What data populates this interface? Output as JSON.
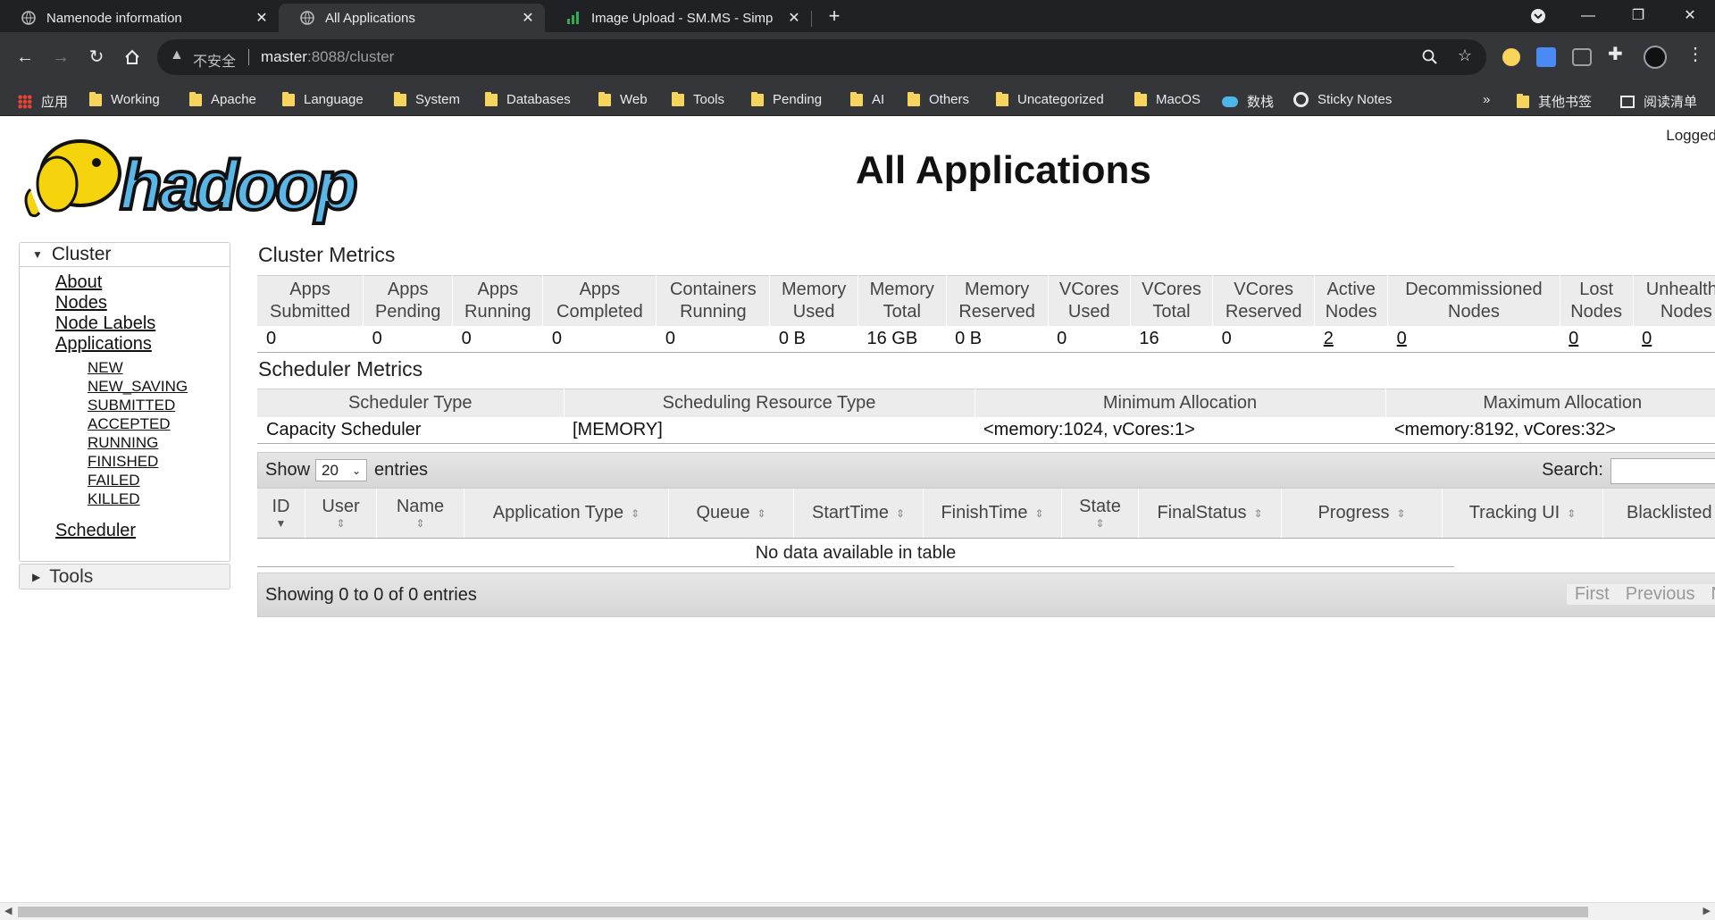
{
  "browser": {
    "tabs": [
      {
        "title": "Namenode information",
        "icon": "globe-icon",
        "close": "✕"
      },
      {
        "title": "All Applications",
        "icon": "globe-icon",
        "close": "✕",
        "active": true
      },
      {
        "title": "Image Upload - SM.MS - Simp",
        "icon": "bar-chart-icon",
        "close": "✕"
      }
    ],
    "new_tab": "+",
    "address": {
      "warning": "▲",
      "insecure": "不安全",
      "host": "master",
      "path": ":8088/cluster"
    },
    "bookmarks": [
      {
        "label": "应用",
        "icon": "apps-grid-icon"
      },
      {
        "label": "Working",
        "icon": "folder-icon"
      },
      {
        "label": "Apache",
        "icon": "folder-icon"
      },
      {
        "label": "Language",
        "icon": "folder-icon"
      },
      {
        "label": "System",
        "icon": "folder-icon"
      },
      {
        "label": "Databases",
        "icon": "folder-icon"
      },
      {
        "label": "Web",
        "icon": "folder-icon"
      },
      {
        "label": "Tools",
        "icon": "folder-icon"
      },
      {
        "label": "Pending",
        "icon": "folder-icon"
      },
      {
        "label": "AI",
        "icon": "folder-icon"
      },
      {
        "label": "Others",
        "icon": "folder-icon"
      },
      {
        "label": "Uncategorized",
        "icon": "folder-icon"
      },
      {
        "label": "MacOS",
        "icon": "folder-icon"
      },
      {
        "label": "数栈",
        "icon": "cloud-icon"
      },
      {
        "label": "Sticky Notes",
        "icon": "chrome-icon"
      }
    ],
    "bookmarks_overflow": "»",
    "other_bookmarks": "其他书签",
    "reading_list": "阅读清单"
  },
  "page": {
    "logged": "Logged",
    "title": "All Applications"
  },
  "nav": {
    "cluster": "Cluster",
    "links": [
      "About",
      "Nodes",
      "Node Labels",
      "Applications"
    ],
    "states": [
      "NEW",
      "NEW_SAVING",
      "SUBMITTED",
      "ACCEPTED",
      "RUNNING",
      "FINISHED",
      "FAILED",
      "KILLED"
    ],
    "scheduler": "Scheduler",
    "tools": "Tools"
  },
  "cluster_metrics": {
    "title": "Cluster Metrics",
    "headers": [
      [
        "Apps",
        "Submitted"
      ],
      [
        "Apps",
        "Pending"
      ],
      [
        "Apps",
        "Running"
      ],
      [
        "Apps",
        "Completed"
      ],
      [
        "Containers",
        "Running"
      ],
      [
        "Memory",
        "Used"
      ],
      [
        "Memory",
        "Total"
      ],
      [
        "Memory",
        "Reserved"
      ],
      [
        "VCores",
        "Used"
      ],
      [
        "VCores",
        "Total"
      ],
      [
        "VCores",
        "Reserved"
      ],
      [
        "Active",
        "Nodes"
      ],
      [
        "Decommissioned",
        "Nodes"
      ],
      [
        "Lost",
        "Nodes"
      ],
      [
        "Unhealthy",
        "Nodes"
      ]
    ],
    "values": [
      "0",
      "0",
      "0",
      "0",
      "0",
      "0 B",
      "16 GB",
      "0 B",
      "0",
      "16",
      "0",
      "2",
      "0",
      "0",
      "0"
    ]
  },
  "scheduler_metrics": {
    "title": "Scheduler Metrics",
    "headers": [
      "Scheduler Type",
      "Scheduling Resource Type",
      "Minimum Allocation",
      "Maximum Allocation"
    ],
    "values": [
      "Capacity Scheduler",
      "[MEMORY]",
      "<memory:1024, vCores:1>",
      "<memory:8192, vCores:32>"
    ]
  },
  "apps_table": {
    "show": "Show",
    "entries_value": "20",
    "entries": "entries",
    "search": "Search:",
    "columns": [
      "ID",
      "User",
      "Name",
      "Application Type",
      "Queue",
      "StartTime",
      "FinishTime",
      "State",
      "FinalStatus",
      "Progress",
      "Tracking UI",
      "Blacklisted"
    ],
    "empty": "No data available in table",
    "info": "Showing 0 to 0 of 0 entries",
    "pager": [
      "First",
      "Previous",
      "N"
    ]
  }
}
